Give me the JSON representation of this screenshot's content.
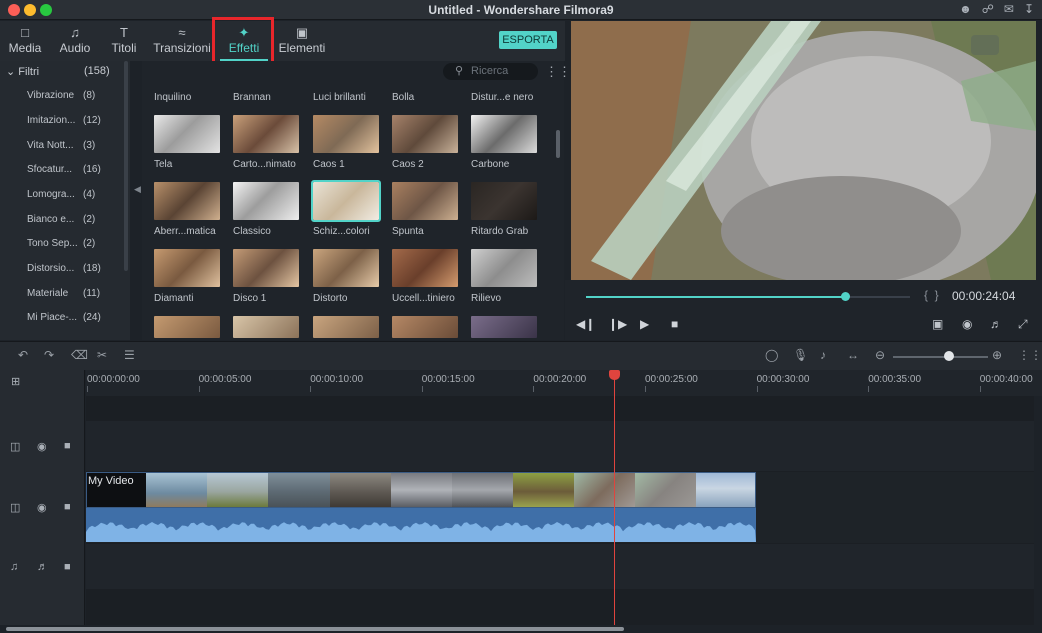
{
  "window": {
    "title": "Untitled - Wondershare Filmora9"
  },
  "media_tabs": [
    {
      "label": "Media",
      "icon": "folder-icon"
    },
    {
      "label": "Audio",
      "icon": "music-note-icon"
    },
    {
      "label": "Titoli",
      "icon": "title-t-icon"
    },
    {
      "label": "Transizioni",
      "icon": "transition-icon"
    },
    {
      "label": "Effetti",
      "icon": "effects-sparkle-icon",
      "active": true
    },
    {
      "label": "Elementi",
      "icon": "image-icon"
    }
  ],
  "export_label": "ESPORTA",
  "search": {
    "placeholder": "Ricerca"
  },
  "sidebar": {
    "header": "Filtri",
    "header_count": "(158)",
    "items": [
      {
        "label": "Vibrazione",
        "count": "(8)"
      },
      {
        "label": "Imitazion...",
        "count": "(12)"
      },
      {
        "label": "Vita Nott...",
        "count": "(3)"
      },
      {
        "label": "Sfocatur...",
        "count": "(16)"
      },
      {
        "label": "Lomogra...",
        "count": "(4)"
      },
      {
        "label": "Bianco e...",
        "count": "(2)"
      },
      {
        "label": "Tono Sep...",
        "count": "(2)"
      },
      {
        "label": "Distorsio...",
        "count": "(18)"
      },
      {
        "label": "Materiale",
        "count": "(11)"
      },
      {
        "label": "Mi Piace-...",
        "count": "(24)"
      }
    ]
  },
  "effects_grid": {
    "top_labels": [
      "Inquilino",
      "Brannan",
      "Luci brillanti",
      "Bolla",
      "Distur...e nero"
    ],
    "rows": [
      [
        "Tela",
        "Carto...nimato",
        "Caos 1",
        "Caos 2",
        "Carbone"
      ],
      [
        "Aberr...matica",
        "Classico",
        "Schiz...colori",
        "Spunta",
        "Ritardo Grab"
      ],
      [
        "Diamanti",
        "Disco 1",
        "Distorto",
        "Uccell...tiniero",
        "Rilievo"
      ]
    ]
  },
  "preview": {
    "timecode": "00:00:24:04",
    "progress": 0.8
  },
  "timeline": {
    "ruler": [
      "00:00:00:00",
      "00:00:05:00",
      "00:00:10:00",
      "00:00:15:00",
      "00:00:20:00",
      "00:00:25:00",
      "00:00:30:00",
      "00:00:35:00",
      "00:00:40:00"
    ],
    "clip_title": "My Video",
    "playhead_time": "00:00:24:04"
  },
  "colors": {
    "accent": "#52d3c8",
    "highlight_box": "#e8262b",
    "playhead": "#e0443e",
    "audio_clip": "#3f6fa8"
  }
}
